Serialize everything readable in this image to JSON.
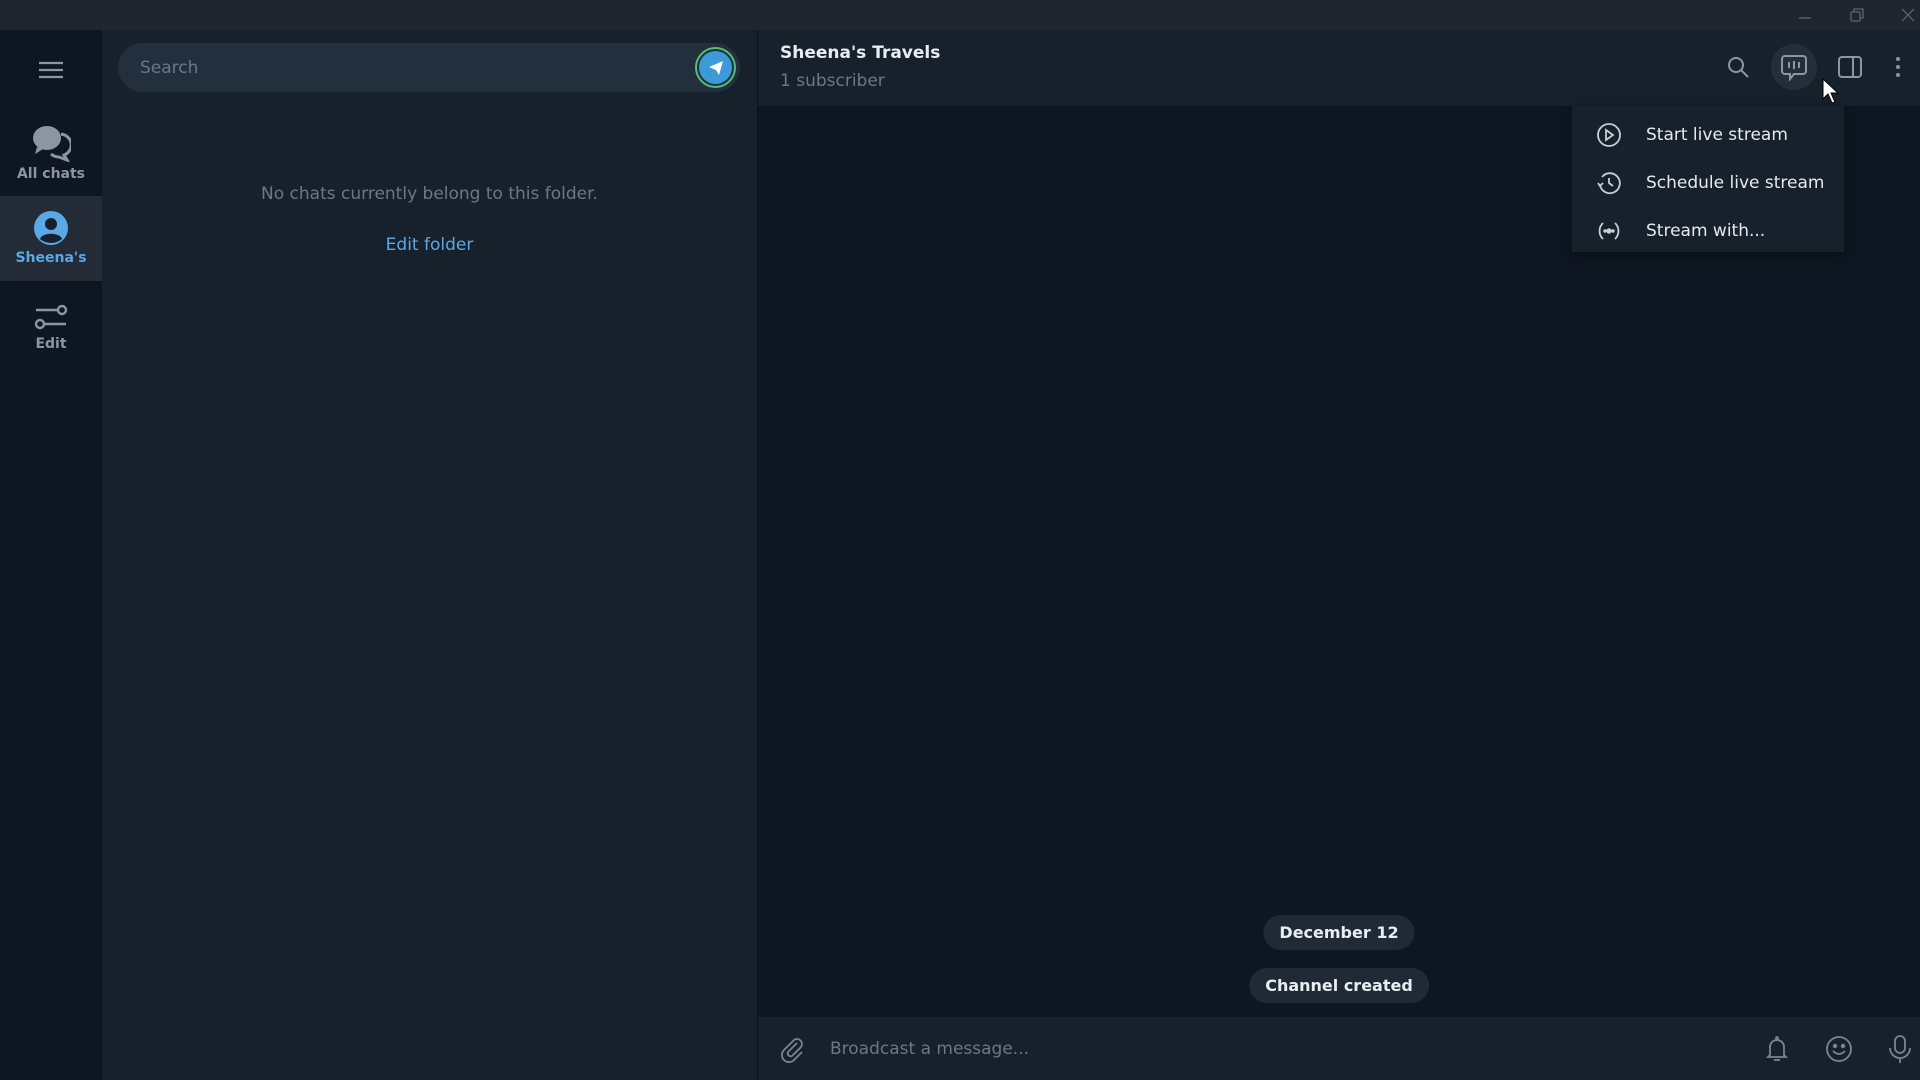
{
  "window": {
    "controls": [
      "minimize",
      "restore",
      "close"
    ]
  },
  "rail": {
    "menu_icon": "hamburger-icon",
    "items": [
      {
        "label": "All chats",
        "icon": "chats-icon",
        "active": false
      },
      {
        "label": "Sheena's",
        "icon": "user-circle-icon",
        "active": true
      },
      {
        "label": "Edit",
        "icon": "sliders-icon",
        "active": false
      }
    ]
  },
  "chatlist": {
    "search": {
      "placeholder": "Search",
      "value": ""
    },
    "empty_text": "No chats currently belong to this folder.",
    "edit_folder_label": "Edit folder"
  },
  "chat": {
    "title": "Sheena's Travels",
    "subtitle": "1 subscriber",
    "header_icons": [
      "search-icon",
      "live-stream-icon",
      "side-panel-icon",
      "more-vertical-icon"
    ],
    "stream_menu": [
      {
        "label": "Start live stream",
        "icon": "play-circle-icon"
      },
      {
        "label": "Schedule live stream",
        "icon": "history-clock-icon"
      },
      {
        "label": "Stream with...",
        "icon": "broadcast-icon"
      }
    ],
    "date_pill": "December 12",
    "service_message": "Channel created",
    "composer": {
      "placeholder": "Broadcast a message...",
      "value": ""
    }
  },
  "colors": {
    "accent": "#5aa9e6",
    "background": "#0e1621",
    "panel": "#17212b"
  }
}
